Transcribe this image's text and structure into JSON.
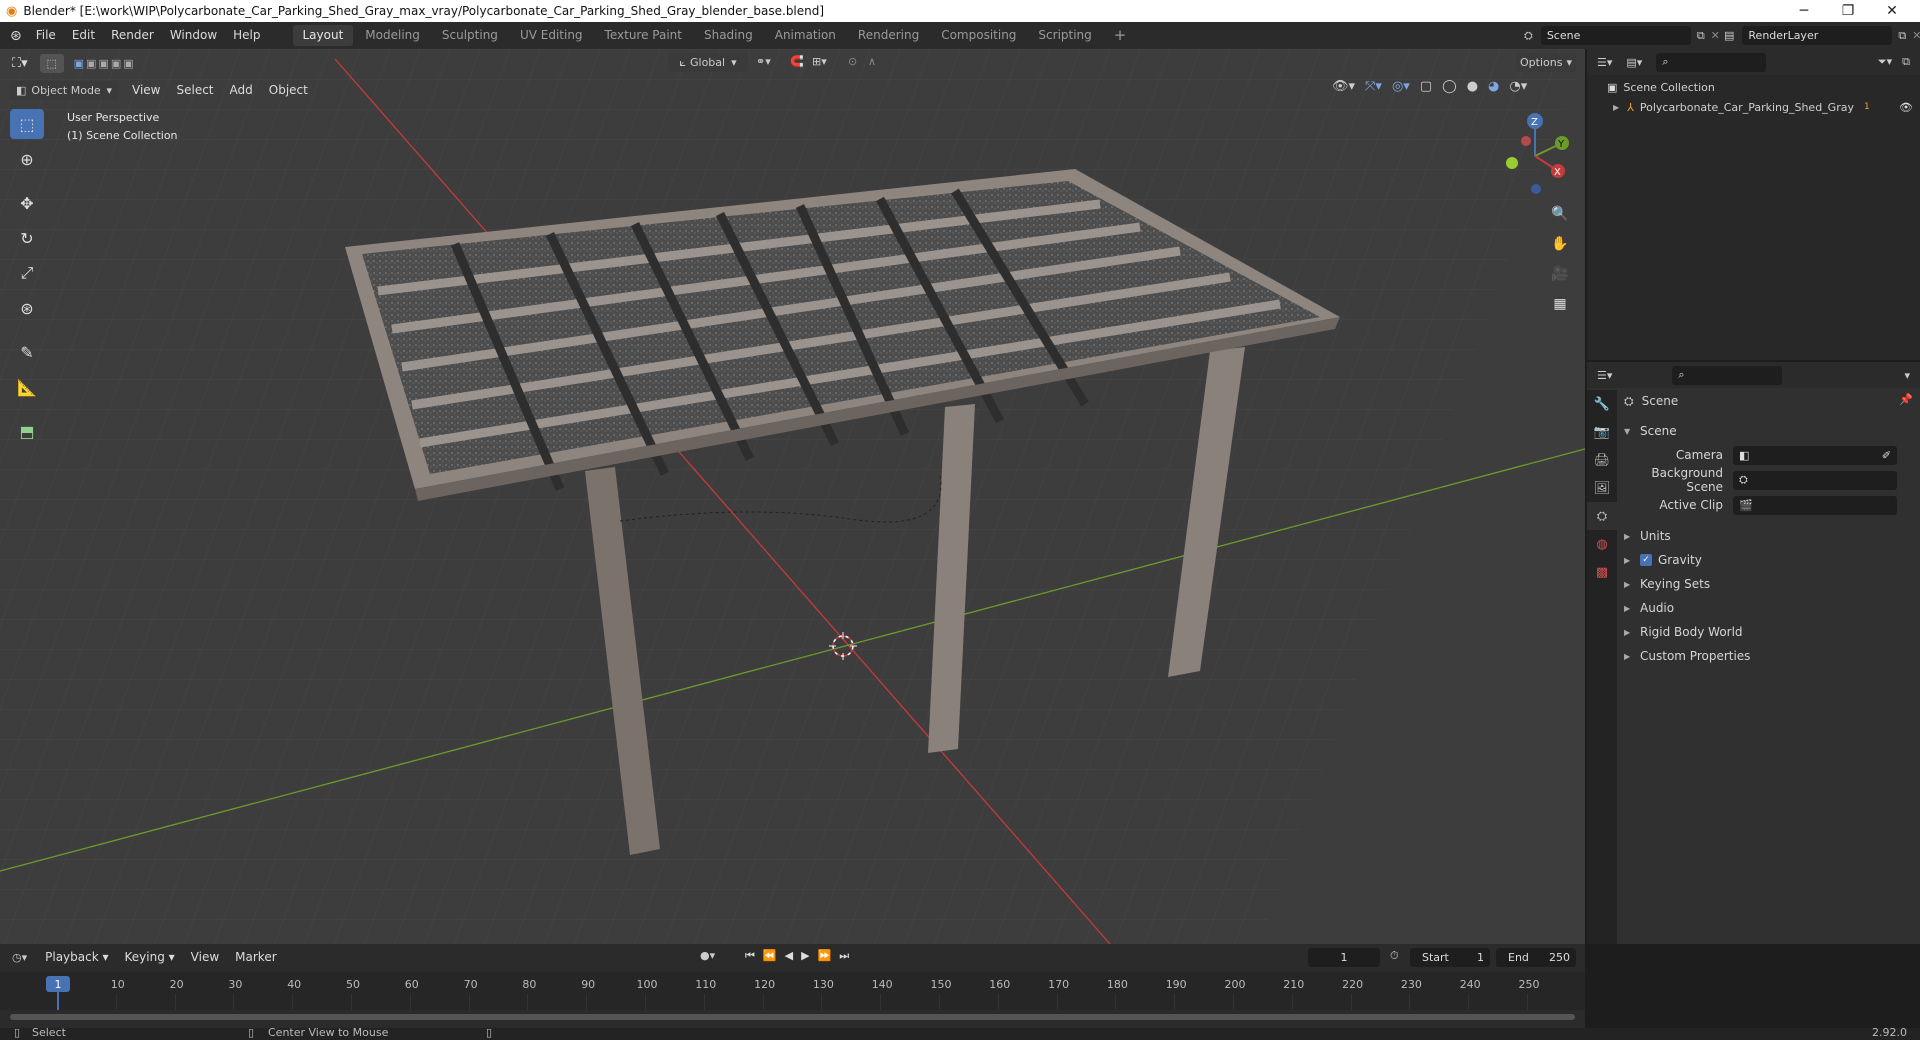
{
  "window": {
    "title": "Blender* [E:\\work\\WIP\\Polycarbonate_Car_Parking_Shed_Gray_max_vray/Polycarbonate_Car_Parking_Shed_Gray_blender_base.blend]",
    "controls": [
      "─",
      "❐",
      "✕"
    ]
  },
  "menubar": {
    "items": [
      "File",
      "Edit",
      "Render",
      "Window",
      "Help"
    ]
  },
  "workspaces": {
    "tabs": [
      "Layout",
      "Modeling",
      "Sculpting",
      "UV Editing",
      "Texture Paint",
      "Shading",
      "Animation",
      "Rendering",
      "Compositing",
      "Scripting"
    ],
    "active": "Layout",
    "add": "+"
  },
  "scene_selector": {
    "value": "Scene"
  },
  "view_layer": {
    "value": "RenderLayer"
  },
  "viewport": {
    "mode": "Object Mode",
    "menus": [
      "View",
      "Select",
      "Add",
      "Object"
    ],
    "transform_orientation": "Global",
    "options": "Options",
    "overlay_text": {
      "line1": "User Perspective",
      "line2": "(1) Scene Collection"
    },
    "gizmo": {
      "z": "Z",
      "y": "Y",
      "x": "X"
    },
    "colors": {
      "x_axis": "#c73a3a",
      "y_axis": "#6b9c2a",
      "bg": "#3d3d3d",
      "grid": "#474747"
    }
  },
  "outliner": {
    "root": "Scene Collection",
    "items": [
      {
        "name": "Polycarbonate_Car_Parking_Shed_Gray",
        "badge": "1"
      }
    ]
  },
  "properties": {
    "header": "Scene",
    "section": "Scene",
    "fields": [
      {
        "label": "Camera",
        "value": ""
      },
      {
        "label": "Background Scene",
        "value": ""
      },
      {
        "label": "Active Clip",
        "value": ""
      }
    ],
    "panels": [
      {
        "label": "Units",
        "checkbox": false
      },
      {
        "label": "Gravity",
        "checkbox": true
      },
      {
        "label": "Keying Sets",
        "checkbox": false
      },
      {
        "label": "Audio",
        "checkbox": false
      },
      {
        "label": "Rigid Body World",
        "checkbox": false
      },
      {
        "label": "Custom Properties",
        "checkbox": false
      }
    ]
  },
  "timeline": {
    "menus": [
      "Playback",
      "Keying",
      "View",
      "Marker"
    ],
    "current_frame": "1",
    "start_label": "Start",
    "start": "1",
    "end_label": "End",
    "end": "250",
    "ticks": [
      "1",
      "10",
      "20",
      "30",
      "40",
      "50",
      "60",
      "70",
      "80",
      "90",
      "100",
      "110",
      "120",
      "130",
      "140",
      "150",
      "160",
      "170",
      "180",
      "190",
      "200",
      "210",
      "220",
      "230",
      "240",
      "250"
    ],
    "accent": "#4772b3"
  },
  "statusbar": {
    "left": "Select",
    "middle": "Center View to Mouse",
    "version": "2.92.0"
  }
}
